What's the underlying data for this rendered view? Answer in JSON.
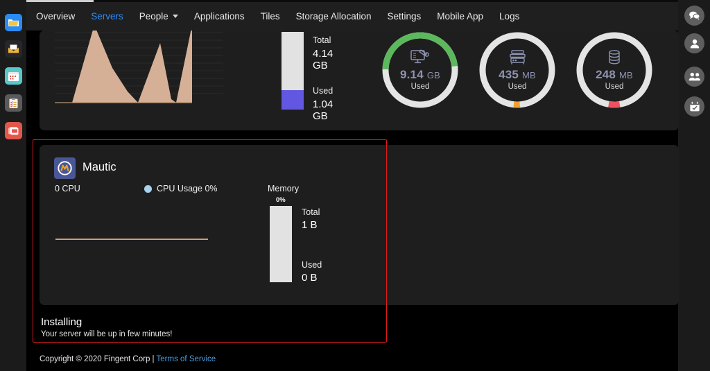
{
  "app": {
    "left_rail_icons": [
      {
        "name": "folder-icon",
        "color": "#2a8bf2"
      },
      {
        "name": "mail-icon",
        "color": "#26272b"
      },
      {
        "name": "calendar-icon",
        "color": "#5bc6c9"
      },
      {
        "name": "clipboard-icon",
        "color": "#5a5a5a"
      },
      {
        "name": "cards-icon",
        "color": "#e2574c"
      }
    ],
    "right_rail_icons": [
      {
        "name": "chat-icon"
      },
      {
        "name": "person-icon"
      },
      {
        "name": "people-icon"
      },
      {
        "name": "calendar-check-icon"
      }
    ]
  },
  "navbar": {
    "items": [
      {
        "label": "Overview",
        "active": false,
        "dropdown": false
      },
      {
        "label": "Servers",
        "active": true,
        "dropdown": false
      },
      {
        "label": "People",
        "active": false,
        "dropdown": true
      },
      {
        "label": "Applications",
        "active": false,
        "dropdown": false
      },
      {
        "label": "Tiles",
        "active": false,
        "dropdown": false
      },
      {
        "label": "Storage Allocation",
        "active": false,
        "dropdown": false
      },
      {
        "label": "Settings",
        "active": false,
        "dropdown": false
      },
      {
        "label": "Mobile App",
        "active": false,
        "dropdown": false
      },
      {
        "label": "Logs",
        "active": false,
        "dropdown": false
      }
    ],
    "active_color": "#2b8dfb"
  },
  "server_panel": {
    "memory": {
      "total_label": "Total",
      "total_value": "4.14 GB",
      "used_label": "Used",
      "used_value": "1.04 GB",
      "used_fill_color": "#6257e0",
      "track_color": "#e2e2e2",
      "used_percent": 25
    },
    "gauges": [
      {
        "icon": "disk-monitor-icon",
        "value": "9.14",
        "unit": "GB",
        "sub": "Used",
        "percent": 48,
        "arc_color": "#5cb85c",
        "track_color": "#e4e4e4"
      },
      {
        "icon": "server-icon",
        "value": "435",
        "unit": "MB",
        "sub": "Used",
        "percent": 3,
        "arc_color": "#f0a030",
        "track_color": "#e4e4e4"
      },
      {
        "icon": "database-icon",
        "value": "248",
        "unit": "MB",
        "sub": "Used",
        "percent": 5,
        "arc_color": "#ef5160",
        "track_color": "#e4e4e4"
      }
    ]
  },
  "mautic_card": {
    "icon": "mautic-logo-icon",
    "title": "Mautic",
    "cpu_count": "0 CPU",
    "cpu_legend_label": "CPU Usage 0%",
    "cpu_legend_color": "#a8d2ef",
    "memory_title": "Memory",
    "memory_percent_label": "0%",
    "memory_total_label": "Total",
    "memory_total_value": "1 B",
    "memory_used_label": "Used",
    "memory_used_value": "0 B",
    "memory_used_percent": 0
  },
  "status": {
    "title": "Installing",
    "subtitle": "Your server will be up in few minutes!",
    "highlight_color": "#e01b1b"
  },
  "footer": {
    "copyright": "Copyright © 2020 Fingent Corp |",
    "link": "Terms of Service"
  },
  "chart_data": [
    {
      "type": "area",
      "title": "",
      "x": [
        0,
        1,
        2,
        3,
        4,
        5,
        6,
        7,
        8,
        9
      ],
      "values": [
        0,
        0,
        98,
        38,
        8,
        0,
        72,
        4,
        0,
        100
      ],
      "ylim": [
        0,
        100
      ],
      "grid": true,
      "fill_color": "#d5b096",
      "xlabel": "",
      "ylabel": ""
    },
    {
      "type": "line",
      "title": "CPU Usage 0%",
      "x": [
        0,
        1,
        2,
        3,
        4,
        5,
        6,
        7,
        8,
        9
      ],
      "values": [
        0,
        0,
        0,
        0,
        0,
        0,
        0,
        0,
        0,
        0
      ],
      "ylim": [
        0,
        100
      ],
      "grid": false,
      "line_color": "#c6a182",
      "xlabel": "",
      "ylabel": ""
    }
  ]
}
